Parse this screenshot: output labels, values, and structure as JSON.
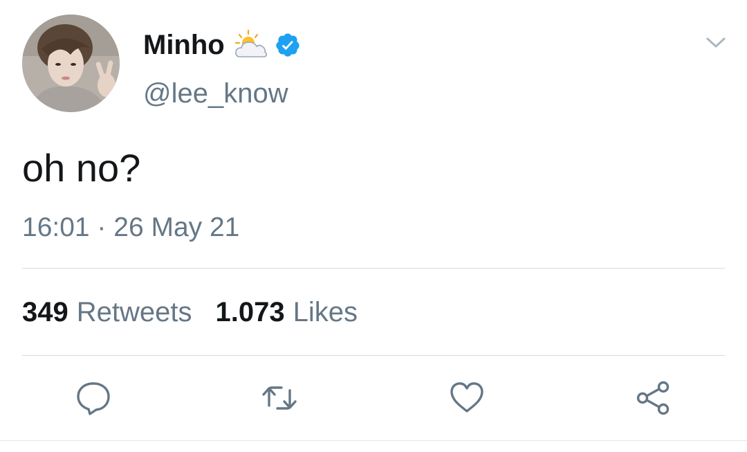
{
  "author": {
    "display_name": "Minho",
    "name_emoji": "sun-behind-cloud",
    "verified_icon": "verified-badge-icon",
    "handle": "@lee_know"
  },
  "tweet": {
    "text": "oh no?",
    "timestamp": "16:01 · 26 May 21"
  },
  "stats": {
    "retweets_count": "349",
    "retweets_label": "Retweets",
    "likes_count": "1.073",
    "likes_label": "Likes"
  },
  "actions": [
    {
      "icon": "reply-icon"
    },
    {
      "icon": "retweet-icon"
    },
    {
      "icon": "like-heart-icon"
    },
    {
      "icon": "share-icon"
    }
  ],
  "colors": {
    "text_primary": "#14171a",
    "text_secondary": "#657786",
    "verified_blue": "#1da1f2",
    "divider": "#d5dbe0"
  }
}
